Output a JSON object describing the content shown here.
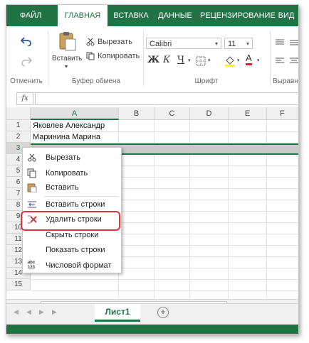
{
  "ribbon_tabs": [
    "ФАЙЛ",
    "ГЛАВНАЯ",
    "ВСТАВКА",
    "ДАННЫЕ",
    "РЕЦЕНЗИРОВАНИЕ",
    "ВИД"
  ],
  "active_tab": "ГЛАВНАЯ",
  "ribbon": {
    "undo_group_label": "Отменить",
    "paste_label": "Вставить",
    "cut_label": "Вырезать",
    "copy_label": "Копировать",
    "clipboard_group_label": "Буфер обмена",
    "font_name": "Calibri",
    "font_size": "11",
    "bold": "Ж",
    "italic": "К",
    "underline": "Ч",
    "font_color_letter": "А",
    "font_group_label": "Шрифт",
    "align_group_label": "Выравн"
  },
  "formula_bar": {
    "fx": "fx",
    "value": ""
  },
  "columns": [
    "A",
    "B",
    "C",
    "D",
    "E",
    "F"
  ],
  "rows": [
    "1",
    "2",
    "3",
    "4",
    "5",
    "6",
    "7",
    "8",
    "9",
    "10",
    "11",
    "12",
    "13",
    "14",
    "15"
  ],
  "cells": {
    "A1": "Яковлев Александр",
    "A2": "Маринина Марина"
  },
  "context_menu": {
    "items": [
      "Вырезать",
      "Копировать",
      "Вставить",
      "Вставить строки",
      "Удалить строки",
      "Скрыть строки",
      "Показать строки",
      "Числовой формат"
    ],
    "number_format_icon_text": "abc 123"
  },
  "sheet_tabs": [
    "Лист1"
  ],
  "add_sheet_label": "+",
  "colors": {
    "excel_green": "#217346",
    "highlight_red": "#d9363e",
    "delete_x_red": "#d23c3c"
  }
}
